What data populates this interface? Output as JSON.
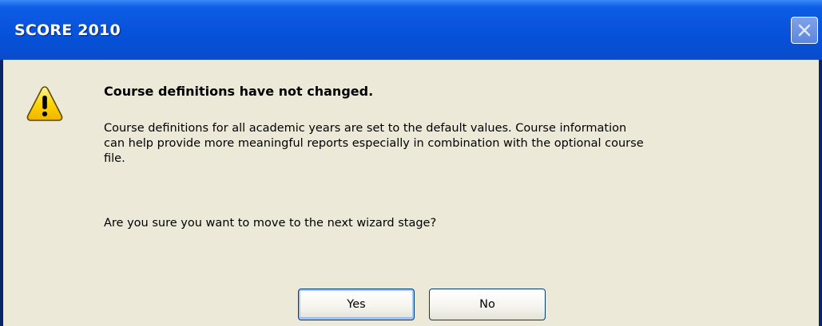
{
  "window": {
    "title": "SCORE 2010"
  },
  "dialog": {
    "icon": "warning-icon",
    "heading": "Course definitions have not changed.",
    "body_lines": [
      "Course definitions for all academic years are set to the default values. Course information",
      "can help provide more meaningful reports especially in combination with the optional course",
      "file."
    ],
    "question": "Are you sure you want to move to the next wizard stage?"
  },
  "buttons": {
    "yes_label": "Yes",
    "no_label": "No"
  },
  "colors": {
    "titlebar": "#0a55de",
    "client_background": "#ece9d8",
    "warning_fill": "#ffd400"
  }
}
